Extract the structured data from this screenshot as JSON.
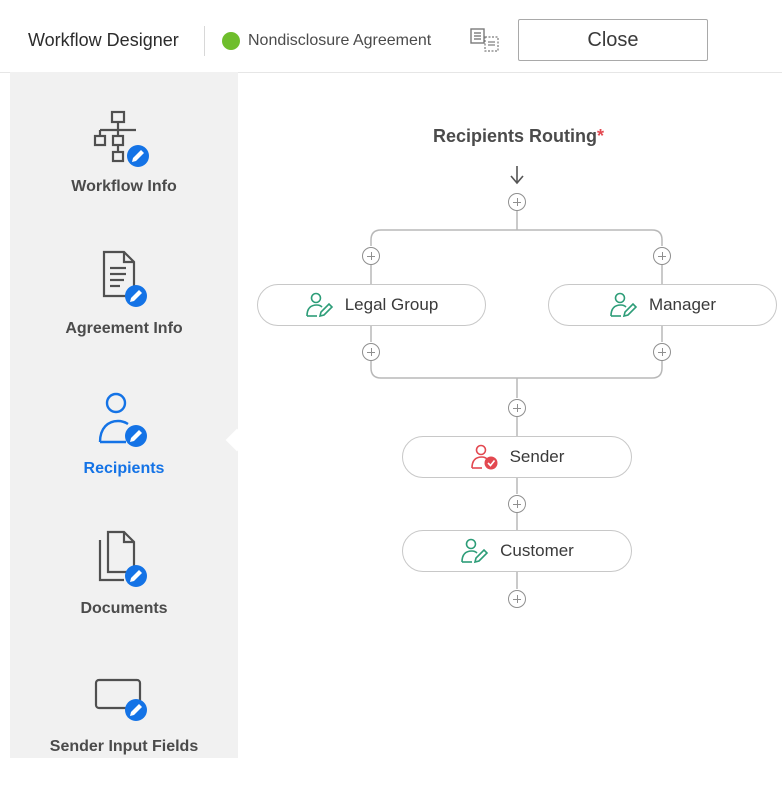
{
  "header": {
    "app_title": "Workflow Designer",
    "agreement_name": "Nondisclosure Agreement",
    "status_color": "#6fbe2c",
    "preview_icon": "preview-icon",
    "close_label": "Close"
  },
  "sidebar": {
    "items": [
      {
        "label": "Workflow Info",
        "icon": "hierarchy-edit-icon",
        "active": false
      },
      {
        "label": "Agreement Info",
        "icon": "document-edit-icon",
        "active": false
      },
      {
        "label": "Recipients",
        "icon": "user-edit-icon",
        "active": true
      },
      {
        "label": "Documents",
        "icon": "files-edit-icon",
        "active": false
      },
      {
        "label": "Sender Input Fields",
        "icon": "field-edit-icon",
        "active": false
      }
    ],
    "active_color": "#1473e6"
  },
  "routing": {
    "title": "Recipients Routing",
    "required_marker": "*",
    "parallel": [
      {
        "label": "Legal Group",
        "role": "signer",
        "icon": "user-sign-icon"
      },
      {
        "label": "Manager",
        "role": "signer",
        "icon": "user-sign-icon"
      }
    ],
    "sequence": [
      {
        "label": "Sender",
        "role": "sender",
        "icon": "user-check-icon"
      },
      {
        "label": "Customer",
        "role": "signer",
        "icon": "user-sign-icon"
      }
    ],
    "signer_color": "#2d9d78",
    "sender_color": "#e34850"
  }
}
